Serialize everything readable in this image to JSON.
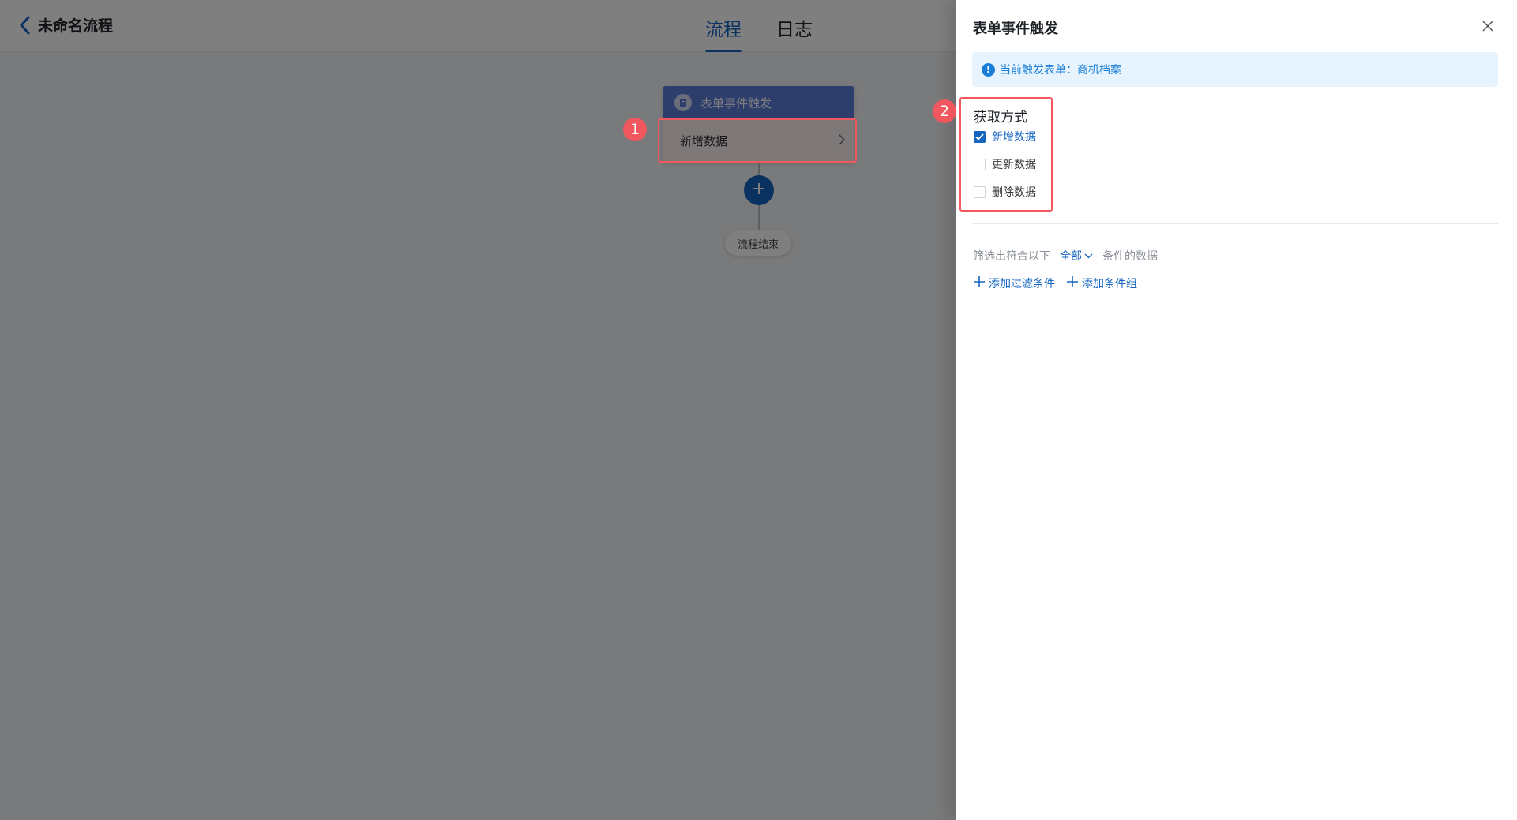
{
  "header": {
    "back_icon": "chevron-left-icon",
    "title": "未命名流程",
    "tabs": [
      {
        "label": "流程",
        "active": true
      },
      {
        "label": "日志",
        "active": false
      }
    ]
  },
  "flow": {
    "trigger_node": {
      "title": "表单事件触发",
      "icon": "form-icon",
      "action": "新增数据"
    },
    "add_icon": "plus-icon",
    "end_label": "流程结束"
  },
  "annotations": {
    "badge1": "1",
    "badge2": "2",
    "color": "#f0575f"
  },
  "drawer": {
    "title": "表单事件触发",
    "close_icon": "close-icon",
    "info": {
      "icon": "info-icon",
      "text": "当前触发表单：商机档案"
    },
    "fetch": {
      "label": "获取方式",
      "options": [
        {
          "label": "新增数据",
          "checked": true
        },
        {
          "label": "更新数据",
          "checked": false
        },
        {
          "label": "删除数据",
          "checked": false
        }
      ]
    },
    "filter": {
      "prefix": "筛选出符合以下",
      "scope": "全部",
      "suffix": "条件的数据",
      "add_condition": "添加过滤条件",
      "add_group": "添加条件组"
    }
  },
  "colors": {
    "primary": "#1565c0",
    "info_bg": "#e8f4fd",
    "highlight": "#f0575f"
  }
}
